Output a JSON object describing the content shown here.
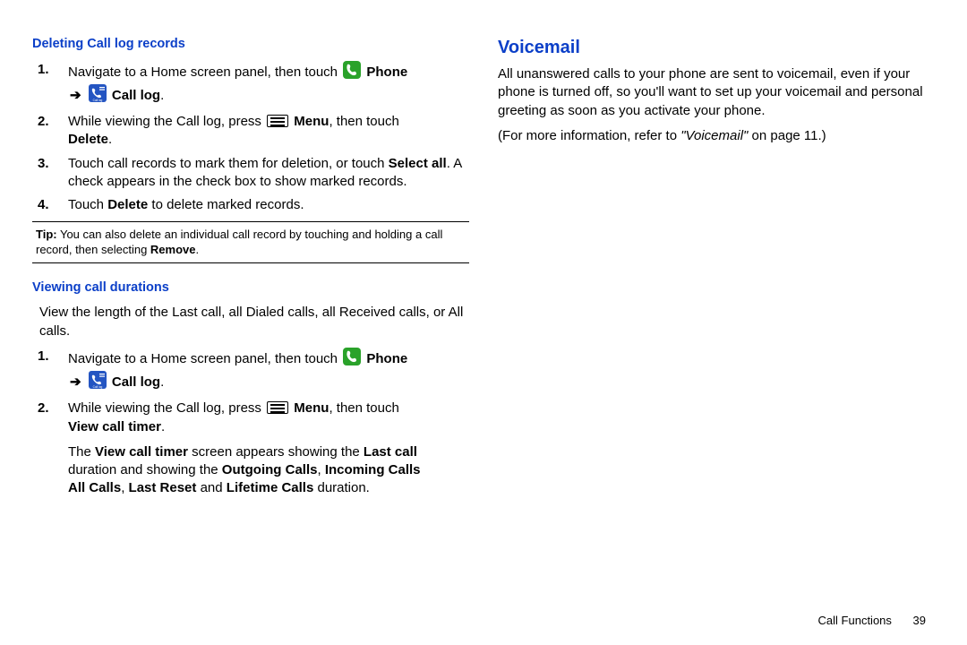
{
  "left": {
    "subheading1": "Deleting Call log records",
    "steps1": {
      "s1_a": "Navigate to a Home screen panel, then touch ",
      "s1_phone": "Phone",
      "s1_calllog": "Call log",
      "s1_period": ".",
      "s2_a": "While viewing the Call log, press ",
      "s2_menu": "Menu",
      "s2_b": ", then touch ",
      "s2_delete": "Delete",
      "s2_period": ".",
      "s3_a": "Touch call records to mark them for deletion, or touch ",
      "s3_selectall": "Select all",
      "s3_b": ". A check appears in the check box to show marked records.",
      "s4_a": "Touch ",
      "s4_delete": "Delete",
      "s4_b": " to delete marked records."
    },
    "tip": {
      "label": "Tip:",
      "text_a": " You can also delete an individual call record by touching and holding a call record, then selecting ",
      "remove": "Remove",
      "period": "."
    },
    "subheading2": "Viewing call durations",
    "intro2": "View the length of the Last call, all Dialed calls, all Received calls, or All calls.",
    "steps2": {
      "s1_a": "Navigate to a Home screen panel, then touch ",
      "s1_phone": "Phone",
      "s1_calllog": "Call log",
      "s1_period": ".",
      "s2_a": "While viewing the Call log, press ",
      "s2_menu": "Menu",
      "s2_b": ", then touch ",
      "s2_vct": "View call timer",
      "s2_period": ".",
      "s2_followA": "The ",
      "s2_followVCT": "View call timer",
      "s2_followB": " screen appears showing the ",
      "s2_lastcall": "Last call",
      "s2_followC": " duration and showing the ",
      "s2_outgoing": "Outgoing Calls",
      "s2_comma1": ", ",
      "s2_incoming": "Incoming Calls",
      "s2_allcalls": "All Calls",
      "s2_comma2": ", ",
      "s2_lastreset": "Last Reset",
      "s2_and": " and ",
      "s2_lifetime": "Lifetime Calls",
      "s2_followD": " duration."
    }
  },
  "right": {
    "heading": "Voicemail",
    "para1": "All unanswered calls to your phone are sent to voicemail, even if your phone is turned off, so you'll want to set up your voicemail and personal greeting as soon as you activate your phone.",
    "para2_a": "(For more information, refer to ",
    "para2_ref": "\"Voicemail\"",
    "para2_b": " on page 11.)"
  },
  "footer": {
    "section": "Call Functions",
    "page": "39"
  },
  "nums": {
    "n1": "1.",
    "n2": "2.",
    "n3": "3.",
    "n4": "4."
  },
  "arrow": "➔"
}
